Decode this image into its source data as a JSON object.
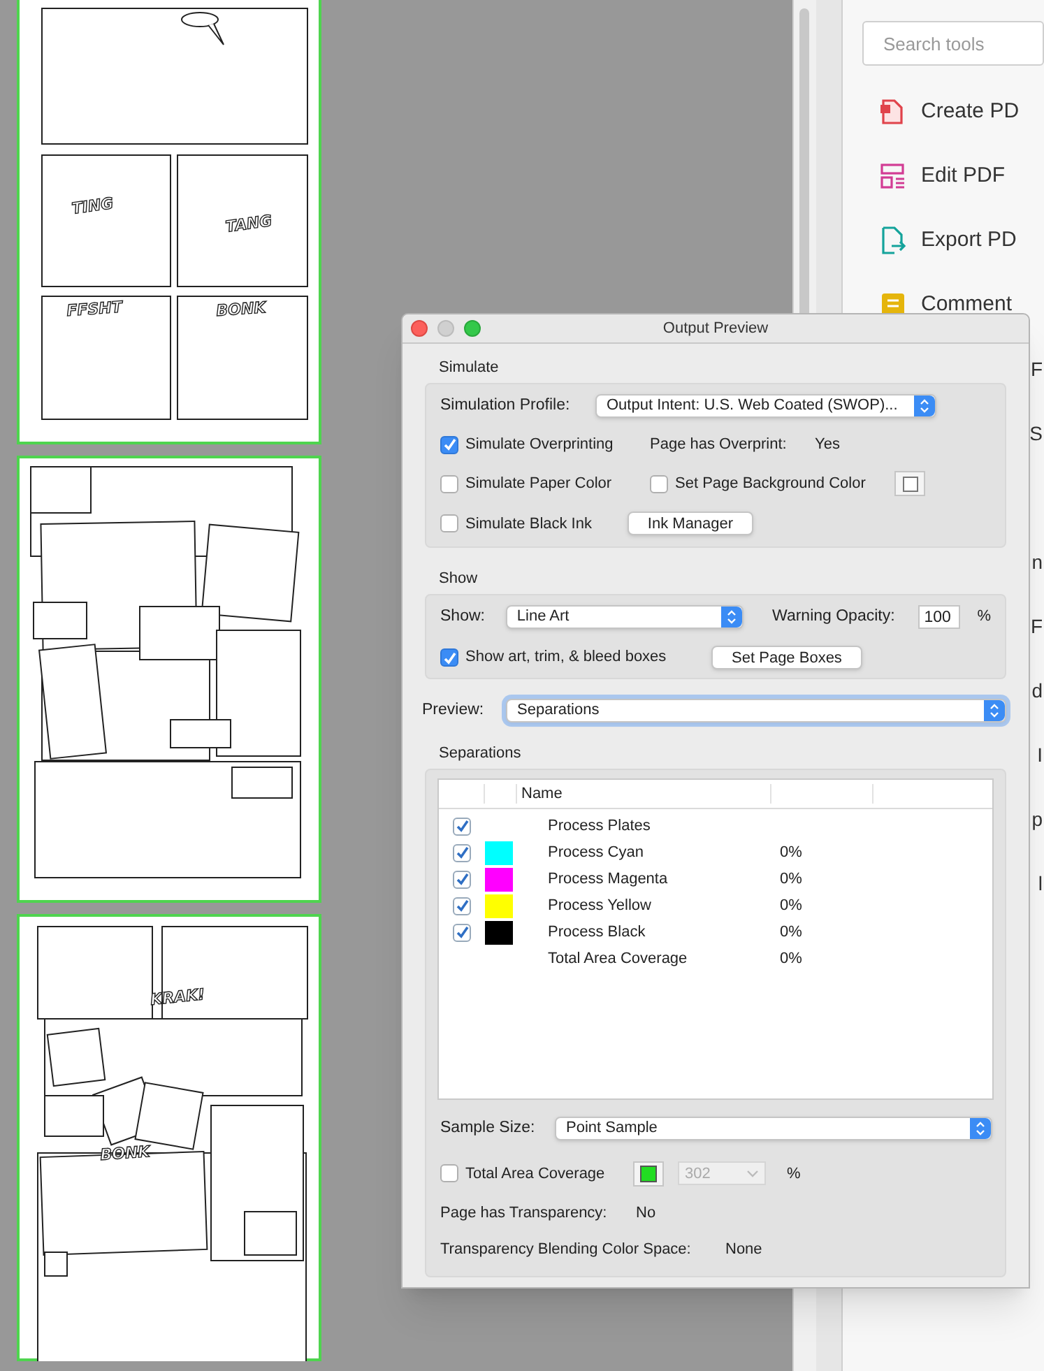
{
  "pages": [
    {
      "kind": "grid",
      "sound_effects": [
        "TING",
        "TANG",
        "FFSHT",
        "BONK"
      ]
    },
    {
      "kind": "collage"
    },
    {
      "kind": "collage2",
      "sound_effects": [
        "KRAK!",
        "BONK"
      ]
    }
  ],
  "tools": {
    "search": {
      "placeholder": "Search tools"
    },
    "items": [
      {
        "label": "Create PD",
        "color": "#e0434b"
      },
      {
        "label": "Edit PDF",
        "color": "#d23c94"
      },
      {
        "label": "Export PD",
        "color": "#14a39b"
      },
      {
        "label": "Comment",
        "color": "#e5b50c"
      }
    ],
    "covered_items": [
      "F",
      "S",
      "n",
      "F",
      "d",
      "I",
      "p",
      "l"
    ]
  },
  "dialog": {
    "title": "Output Preview",
    "simulate": {
      "heading": "Simulate",
      "profile_label": "Simulation Profile:",
      "profile_value": "Output Intent: U.S. Web Coated (SWOP)...",
      "overprinting": {
        "label": "Simulate Overprinting",
        "checked": true
      },
      "overprint_label": "Page has Overprint:",
      "overprint_value": "Yes",
      "paper_color": {
        "label": "Simulate Paper Color",
        "checked": false
      },
      "page_background": {
        "label": "Set Page Background Color",
        "checked": false
      },
      "black_ink": {
        "label": "Simulate Black Ink",
        "checked": false
      },
      "ink_manager_button": "Ink Manager"
    },
    "show": {
      "heading": "Show",
      "show_label": "Show:",
      "show_value": "Line Art",
      "opacity_label": "Warning Opacity:",
      "opacity_value": "100",
      "opacity_unit": "%",
      "boxes": {
        "label": "Show art, trim, & bleed boxes",
        "checked": true
      },
      "page_boxes_button": "Set Page Boxes"
    },
    "preview": {
      "label": "Preview:",
      "value": "Separations"
    },
    "separations": {
      "heading": "Separations",
      "columns": [
        "Name"
      ],
      "rows": [
        {
          "kind": "plate",
          "checked": true,
          "name": "Process Plates"
        },
        {
          "kind": "plate",
          "checked": true,
          "color": "#00ffff",
          "name": "Process Cyan",
          "coverage": "0%"
        },
        {
          "kind": "plate",
          "checked": true,
          "color": "#ff00ff",
          "name": "Process Magenta",
          "coverage": "0%"
        },
        {
          "kind": "plate",
          "checked": true,
          "color": "#ffff00",
          "name": "Process Yellow",
          "coverage": "0%"
        },
        {
          "kind": "plate",
          "checked": true,
          "color": "#000000",
          "name": "Process Black",
          "coverage": "0%"
        },
        {
          "kind": "total",
          "name": "Total Area Coverage",
          "coverage": "0%"
        }
      ],
      "sample_label": "Sample Size:",
      "sample_value": "Point Sample",
      "coverage": {
        "label": "Total Area Coverage",
        "checked": false,
        "color": "#22dd22",
        "value": "302",
        "unit": "%"
      },
      "transparency_label": "Page has Transparency:",
      "transparency_value": "No",
      "blending_label": "Transparency Blending Color Space:",
      "blending_value": "None"
    }
  }
}
